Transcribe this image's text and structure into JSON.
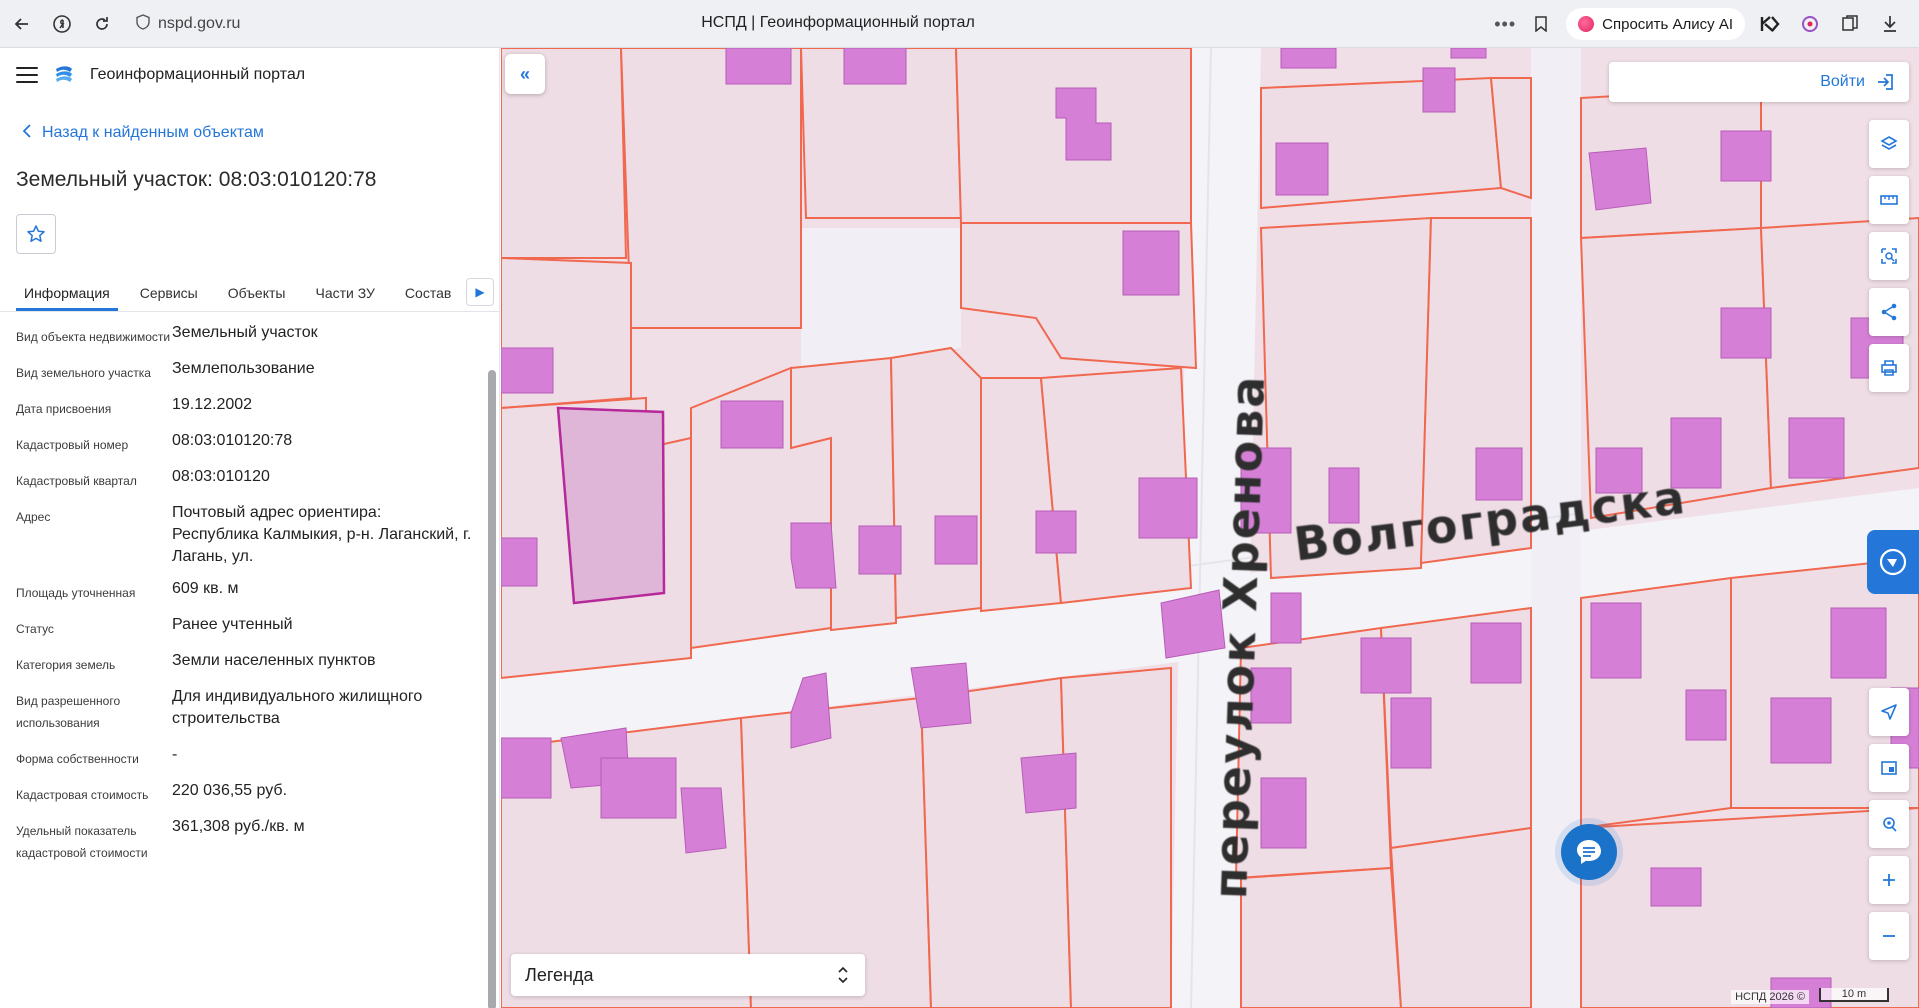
{
  "browser": {
    "url": "nspd.gov.ru",
    "tab_title": "НСПД | Геоинформационный портал",
    "menu_dots": "•••",
    "alice_label": "Спросить Алису AI"
  },
  "portal": {
    "title": "Геоинформационный портал",
    "back_link": "Назад к найденным объектам",
    "object_title": "Земельный участок: 08:03:010120:78"
  },
  "tabs": [
    {
      "label": "Информация"
    },
    {
      "label": "Сервисы"
    },
    {
      "label": "Объекты"
    },
    {
      "label": "Части ЗУ"
    },
    {
      "label": "Состав"
    }
  ],
  "properties": [
    {
      "label": "Вид объекта недвижимости",
      "value": "Земельный участок"
    },
    {
      "label": "Вид земельного участка",
      "value": "Землепользование"
    },
    {
      "label": "Дата присвоения",
      "value": "19.12.2002"
    },
    {
      "label": "Кадастровый номер",
      "value": "08:03:010120:78"
    },
    {
      "label": "Кадастровый квартал",
      "value": "08:03:010120"
    },
    {
      "label": "Адрес",
      "value": "Почтовый адрес ориентира: Республика Калмыкия, р-н. Лаганский, г. Лагань, ул."
    },
    {
      "label": "Площадь уточненная",
      "value": "609 кв. м"
    },
    {
      "label": "Статус",
      "value": "Ранее учтенный"
    },
    {
      "label": "Категория земель",
      "value": "Земли населенных пунктов"
    },
    {
      "label": "Вид разрешенного использования",
      "value": "Для индивидуального жилищного строительства"
    },
    {
      "label": "Форма собственности",
      "value": "-"
    },
    {
      "label": "Кадастровая стоимость",
      "value": "220 036,55 руб."
    },
    {
      "label": "Удельный показатель кадастровой стоимости",
      "value": "361,308 руб./кв. м"
    }
  ],
  "map": {
    "street_1": "Волгоградска",
    "street_2": "переулок Хренова",
    "login_label": "Войти",
    "legend_label": "Легенда",
    "copyright": "НСПД 2026 ©",
    "scale": "10 m",
    "colors": {
      "parcel_fill": "#efdde5",
      "parcel_stroke": "#f0684f",
      "building_fill": "#d580d6",
      "selected_fill": "#dfb6d7",
      "selected_stroke": "#b5299a",
      "road": "#f4f3f8",
      "accent": "#2477d8"
    }
  },
  "icons": [
    "back-arrow-icon",
    "yandex-icon",
    "reload-icon",
    "shield-icon",
    "bookmark-icon",
    "star-icon",
    "layers-icon",
    "ruler-icon",
    "select-area-icon",
    "share-icon",
    "print-icon",
    "navigate-icon",
    "minimap-icon",
    "locate-icon",
    "zoom-in-icon",
    "zoom-out-icon",
    "chat-icon",
    "login-icon"
  ]
}
